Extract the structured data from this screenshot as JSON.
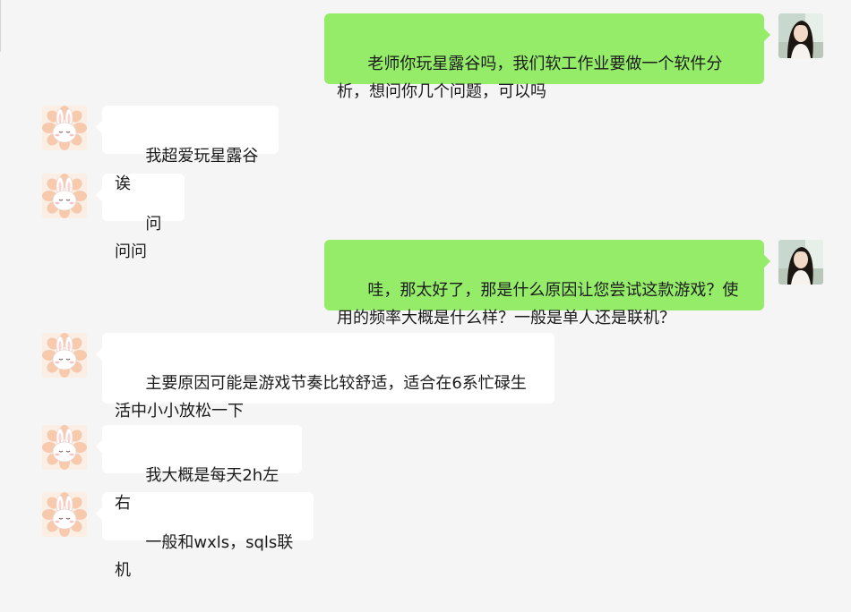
{
  "conversation": {
    "messages": [
      {
        "sender": "me",
        "text": "老师你玩星露谷吗，我们软工作业要做一个软件分析，想问你几个问题，可以吗"
      },
      {
        "sender": "teacher",
        "text": "我超爱玩星露谷诶"
      },
      {
        "sender": "teacher",
        "text": "问问问"
      },
      {
        "sender": "me",
        "text": "哇，那太好了，那是什么原因让您尝试这款游戏？使用的频率大概是什么样？一般是单人还是联机？"
      },
      {
        "sender": "teacher",
        "text": "主要原因可能是游戏节奏比较舒适，适合在6系忙碌生活中小小放松一下"
      },
      {
        "sender": "teacher",
        "text": "我大概是每天2h左右"
      },
      {
        "sender": "teacher",
        "text": "一般和wxls，sqls联机"
      }
    ]
  },
  "colors": {
    "background": "#f5f5f5",
    "outgoing_bubble": "#95ec69",
    "incoming_bubble": "#ffffff"
  },
  "icons": {
    "self_avatar": "girl-portrait-avatar-icon",
    "teacher_avatar": "bunny-flower-avatar-icon"
  }
}
